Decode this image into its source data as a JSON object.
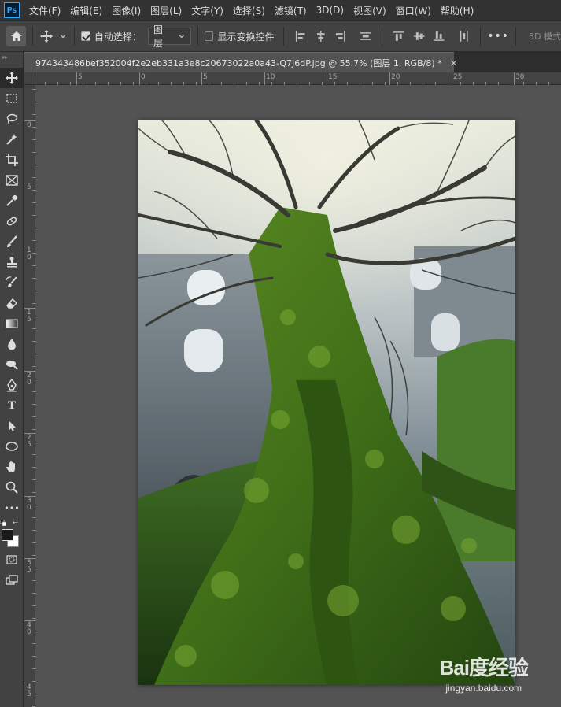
{
  "app": {
    "logo_text": "Ps"
  },
  "menu": [
    {
      "label": "文件(F)"
    },
    {
      "label": "编辑(E)"
    },
    {
      "label": "图像(I)"
    },
    {
      "label": "图层(L)"
    },
    {
      "label": "文字(Y)"
    },
    {
      "label": "选择(S)"
    },
    {
      "label": "滤镜(T)"
    },
    {
      "label": "3D(D)"
    },
    {
      "label": "视图(V)"
    },
    {
      "label": "窗口(W)"
    },
    {
      "label": "帮助(H)"
    }
  ],
  "options": {
    "auto_select_label": "自动选择：",
    "auto_select_checked": true,
    "auto_select_target": "图层",
    "show_transform_label": "显示变换控件",
    "show_transform_checked": false,
    "more_label": "•••",
    "mode_3d_label": "3D 模式"
  },
  "document": {
    "tab_title": "974343486bef352004f2e2eb331a3e8c20673022a0a43-Q7J6dP.jpg @ 55.7% (图层 1, RGB/8) *",
    "close_symbol": "×"
  },
  "rulers": {
    "horizontal_labels": [
      "5",
      "0",
      "5",
      "10",
      "15",
      "20",
      "25",
      "30"
    ],
    "vertical_labels": [
      "0",
      "5",
      "1 0",
      "1 5",
      "2 0",
      "2 5",
      "3 0",
      "3 5",
      "4 0",
      "4 5"
    ]
  },
  "tools": [
    {
      "name": "move-tool-icon",
      "active": true
    },
    {
      "name": "rectangular-marquee-tool-icon"
    },
    {
      "name": "lasso-tool-icon"
    },
    {
      "name": "magic-wand-tool-icon"
    },
    {
      "name": "crop-tool-icon"
    },
    {
      "name": "frame-tool-icon"
    },
    {
      "name": "eyedropper-tool-icon"
    },
    {
      "name": "healing-brush-tool-icon"
    },
    {
      "name": "brush-tool-icon"
    },
    {
      "name": "clone-stamp-tool-icon"
    },
    {
      "name": "history-brush-tool-icon"
    },
    {
      "name": "eraser-tool-icon"
    },
    {
      "name": "gradient-tool-icon"
    },
    {
      "name": "blur-tool-icon"
    },
    {
      "name": "dodge-tool-icon"
    },
    {
      "name": "pen-tool-icon"
    },
    {
      "name": "type-tool-icon",
      "glyph": "T"
    },
    {
      "name": "path-selection-tool-icon"
    },
    {
      "name": "ellipse-tool-icon"
    },
    {
      "name": "hand-tool-icon"
    },
    {
      "name": "zoom-tool-icon"
    },
    {
      "name": "edit-toolbar-icon",
      "glyph": "•••"
    }
  ],
  "colors": {
    "foreground": "#1a1818",
    "background": "#ffffff"
  },
  "watermark": {
    "logo": "Bai度经验",
    "url": "jingyan.baidu.com"
  }
}
